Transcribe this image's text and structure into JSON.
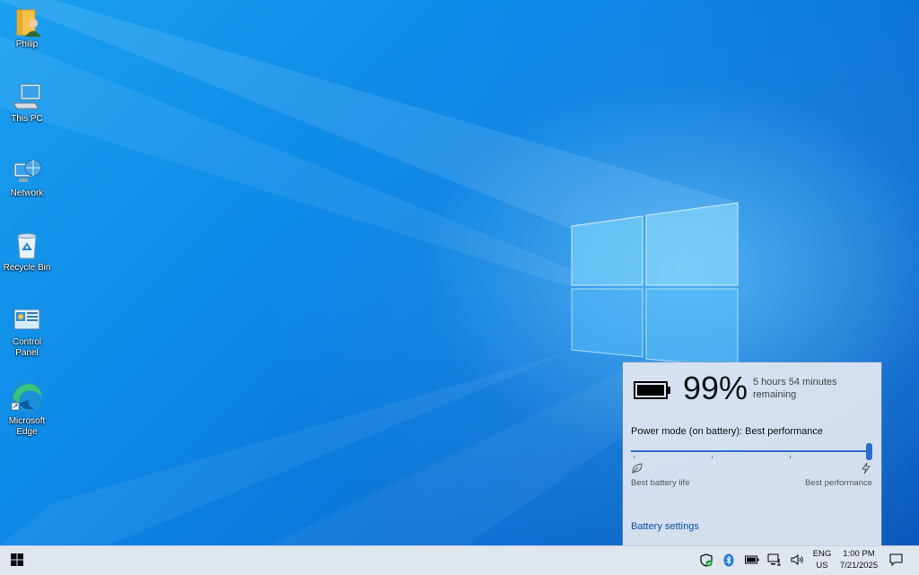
{
  "desktop": {
    "icons": [
      {
        "label": "Philip",
        "icon": "user-folder-icon"
      },
      {
        "label": "This PC",
        "icon": "computer-icon"
      },
      {
        "label": "Network",
        "icon": "network-icon"
      },
      {
        "label": "Recycle Bin",
        "icon": "recycle-bin-icon"
      },
      {
        "label": "Control Panel",
        "icon": "control-panel-icon"
      },
      {
        "label": "Microsoft Edge",
        "icon": "edge-icon"
      }
    ]
  },
  "battery_flyout": {
    "percent": "99%",
    "remaining": "5 hours 54 minutes remaining",
    "power_mode_label": "Power mode (on battery): Best performance",
    "slider_level": 1.0,
    "left_label": "Best battery life",
    "right_label": "Best performance",
    "settings_link": "Battery settings",
    "accent_color": "#2a6fc9"
  },
  "taskbar": {
    "start_icon": "windows-start-icon",
    "tray_icons": [
      "windows-security-icon",
      "bluetooth-icon",
      "battery-icon",
      "network-icon",
      "volume-icon"
    ],
    "language": {
      "line1": "ENG",
      "line2": "US"
    },
    "clock": {
      "time": "1:00 PM",
      "date": "7/21/2025"
    },
    "notification_icon": "action-center-icon"
  }
}
